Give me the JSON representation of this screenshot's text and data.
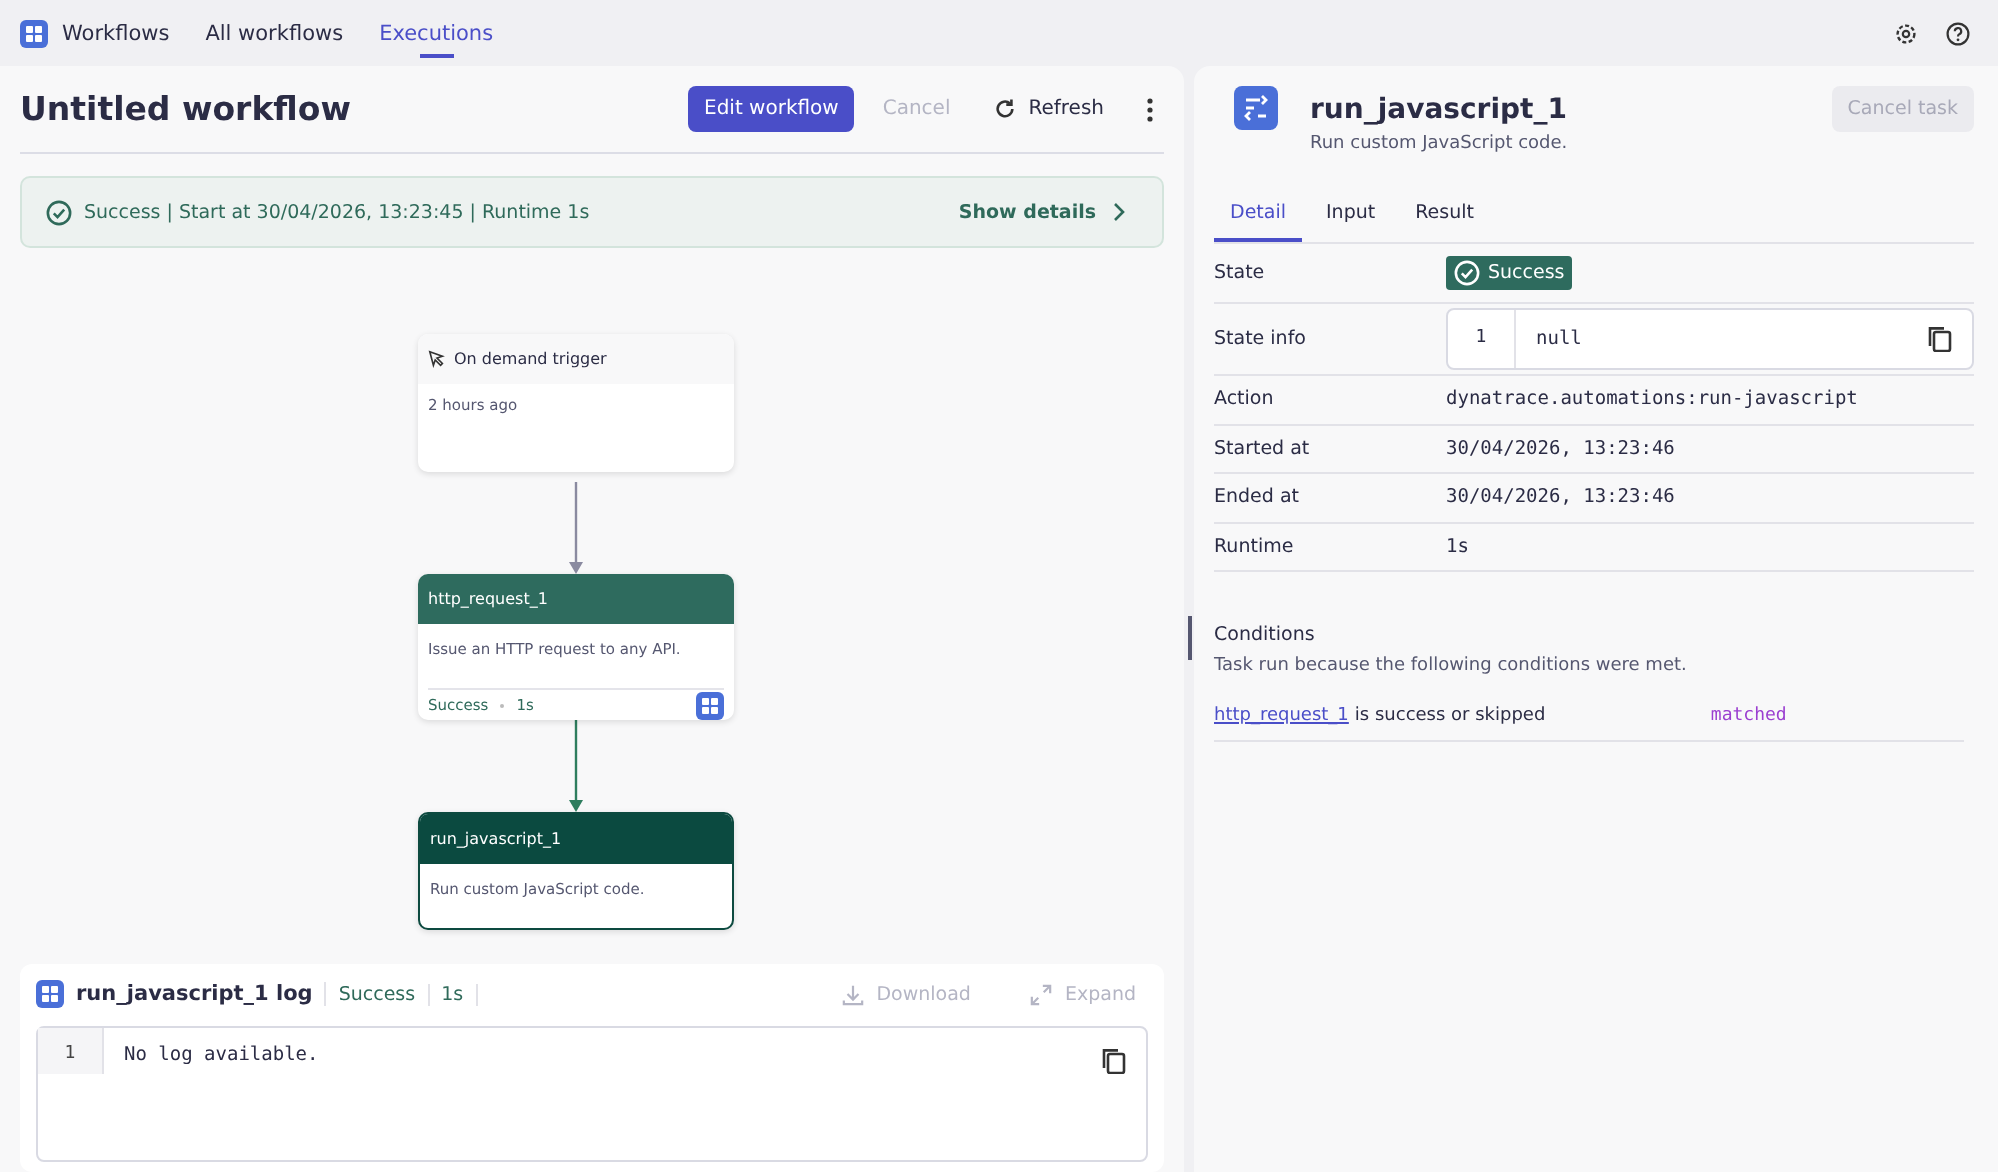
{
  "nav": {
    "app": "Workflows",
    "tabs": [
      {
        "label": "All workflows",
        "selected": false
      },
      {
        "label": "Executions",
        "selected": true
      }
    ]
  },
  "workflow": {
    "title": "Untitled workflow",
    "buttons": [
      {
        "label": "Edit workflow",
        "kind": "primary",
        "disabled": false
      },
      {
        "label": "Cancel",
        "kind": "plain",
        "disabled": true
      },
      {
        "label": "Refresh",
        "kind": "refresh",
        "disabled": false
      }
    ],
    "banner": {
      "text": "Success | Start at 30/04/2026, 13:23:45 | Runtime 1s",
      "action": "Show details"
    }
  },
  "nodes": [
    {
      "kind": "trigger",
      "title": "On demand trigger",
      "subtitle": "2 hours ago",
      "selected": false
    },
    {
      "kind": "task",
      "title": "http_request_1",
      "subtitle": "Issue an HTTP request to any API.",
      "status": "Success",
      "runtime": "1s",
      "selected": false
    },
    {
      "kind": "task",
      "title": "run_javascript_1",
      "subtitle": "Run custom JavaScript code.",
      "selected": true
    }
  ],
  "log": {
    "title": "run_javascript_1 log",
    "status": "Success",
    "runtime": "1s",
    "actions": [
      {
        "label": "Download",
        "kind": "download",
        "disabled": true
      },
      {
        "label": "Expand",
        "kind": "expand",
        "disabled": true
      }
    ],
    "lines": [
      {
        "number": "1",
        "text": "No log available."
      }
    ]
  },
  "task": {
    "title": "run_javascript_1",
    "subtitle": "Run custom JavaScript code.",
    "cancel": {
      "label": "Cancel task",
      "disabled": true
    },
    "tabs": [
      {
        "label": "Detail",
        "selected": true
      },
      {
        "label": "Input",
        "selected": false
      },
      {
        "label": "Result",
        "selected": false
      }
    ],
    "rows": [
      {
        "label": "State",
        "kind": "badge",
        "value": "Success"
      },
      {
        "label": "State info",
        "kind": "code",
        "line": "1",
        "value": "null"
      },
      {
        "label": "Action",
        "kind": "mono",
        "value": "dynatrace.automations:run-javascript"
      },
      {
        "label": "Started at",
        "kind": "mono",
        "value": "30/04/2026, 13:23:46"
      },
      {
        "label": "Ended at",
        "kind": "mono",
        "value": "30/04/2026, 13:23:46"
      },
      {
        "label": "Runtime",
        "kind": "mono",
        "value": "1s"
      }
    ],
    "conditions": {
      "title": "Conditions",
      "description": "Task run because the following conditions were met.",
      "items": [
        {
          "link": "http_request_1",
          "text": "is success or skipped",
          "result": "matched"
        }
      ]
    }
  }
}
